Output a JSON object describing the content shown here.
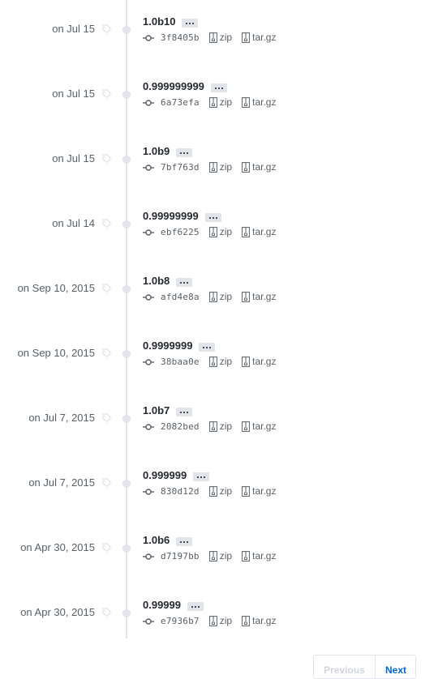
{
  "releases": [
    {
      "date": "on Jul 15",
      "version": "1.0b10",
      "sha": "3f8405b",
      "zip": "zip",
      "targz": "tar.gz"
    },
    {
      "date": "on Jul 15",
      "version": "0.999999999",
      "sha": "6a73efa",
      "zip": "zip",
      "targz": "tar.gz"
    },
    {
      "date": "on Jul 15",
      "version": "1.0b9",
      "sha": "7bf763d",
      "zip": "zip",
      "targz": "tar.gz"
    },
    {
      "date": "on Jul 14",
      "version": "0.99999999",
      "sha": "ebf6225",
      "zip": "zip",
      "targz": "tar.gz"
    },
    {
      "date": "on Sep 10, 2015",
      "version": "1.0b8",
      "sha": "afd4e8a",
      "zip": "zip",
      "targz": "tar.gz"
    },
    {
      "date": "on Sep 10, 2015",
      "version": "0.9999999",
      "sha": "38baa0e",
      "zip": "zip",
      "targz": "tar.gz"
    },
    {
      "date": "on Jul 7, 2015",
      "version": "1.0b7",
      "sha": "2082bed",
      "zip": "zip",
      "targz": "tar.gz"
    },
    {
      "date": "on Jul 7, 2015",
      "version": "0.999999",
      "sha": "830d12d",
      "zip": "zip",
      "targz": "tar.gz"
    },
    {
      "date": "on Apr 30, 2015",
      "version": "1.0b6",
      "sha": "d7197bb",
      "zip": "zip",
      "targz": "tar.gz"
    },
    {
      "date": "on Apr 30, 2015",
      "version": "0.99999",
      "sha": "e7936b7",
      "zip": "zip",
      "targz": "tar.gz"
    }
  ],
  "icons": {
    "tag": "tag-icon",
    "commit": "git-commit-icon",
    "archive": "file-zip-icon",
    "ellipsis": "ellipsis-icon"
  },
  "pagination": {
    "previous_label": "Previous",
    "next_label": "Next"
  },
  "colors": {
    "timeline": "#e1e4e8",
    "text_muted": "#586069",
    "link": "#0366d6",
    "disabled": "#d1d5da"
  }
}
